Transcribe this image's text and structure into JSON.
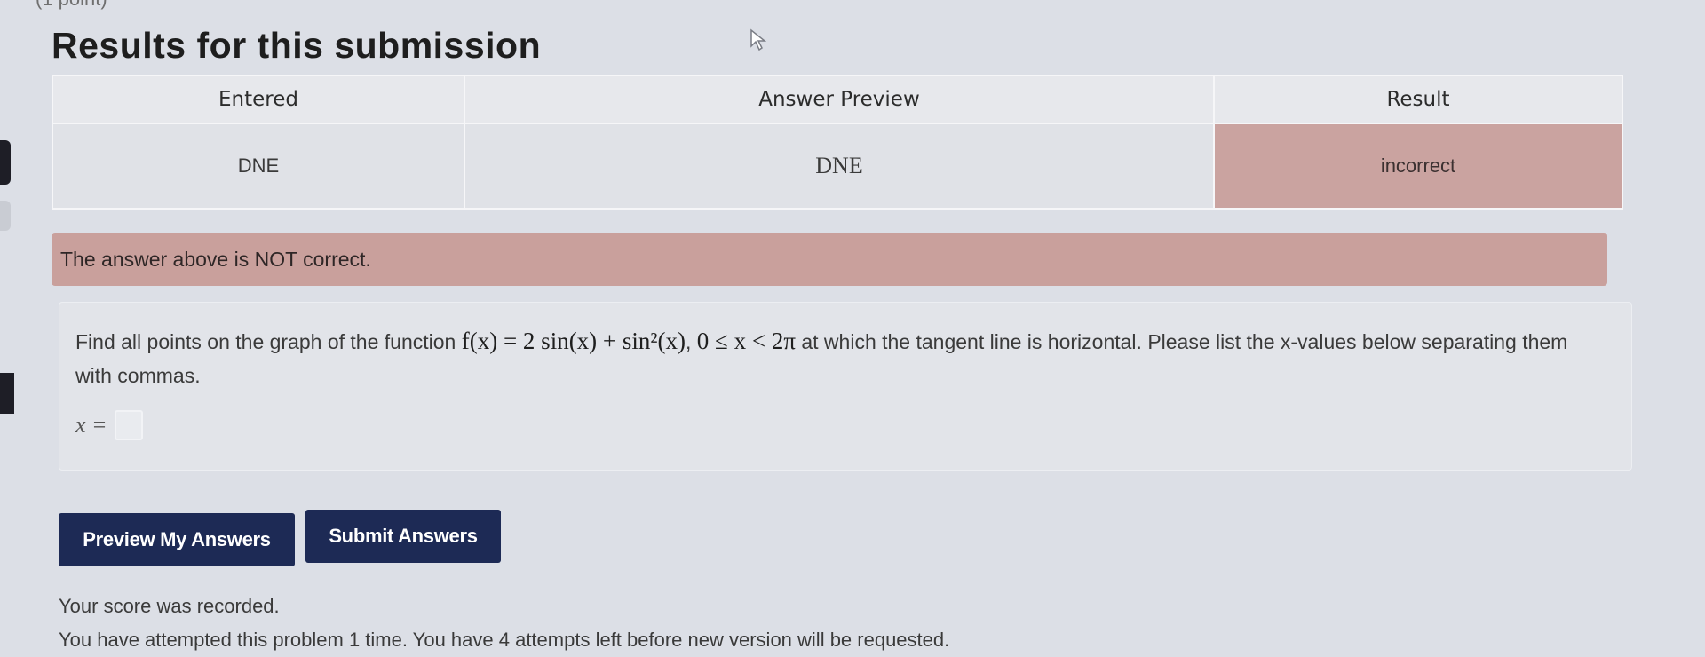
{
  "page": {
    "top_fragment": "(1 point)",
    "title": "Results for this submission"
  },
  "results_table": {
    "headers": {
      "entered": "Entered",
      "preview": "Answer Preview",
      "result": "Result"
    },
    "row": {
      "entered": "DNE",
      "preview": "DNE",
      "result": "incorrect"
    }
  },
  "alert": {
    "message": "The answer above is NOT correct."
  },
  "problem": {
    "text_before": "Find all points on the graph of the function ",
    "function": "f(x) = 2 sin(x) + sin²(x)",
    "domain": "0 ≤ x < 2π",
    "text_after": " at which the tangent line is horizontal. Please list the x-values below separating them with commas.",
    "answer_label": "x =",
    "answer_value": ""
  },
  "buttons": {
    "preview": "Preview My Answers",
    "submit": "Submit Answers"
  },
  "status": {
    "recorded": "Your score was recorded.",
    "attempts": "You have attempted this problem 1 time. You have 4 attempts left before new version will be requested."
  },
  "colors": {
    "incorrect_bg": "#caa3a0",
    "button_bg": "#1d2a55"
  }
}
